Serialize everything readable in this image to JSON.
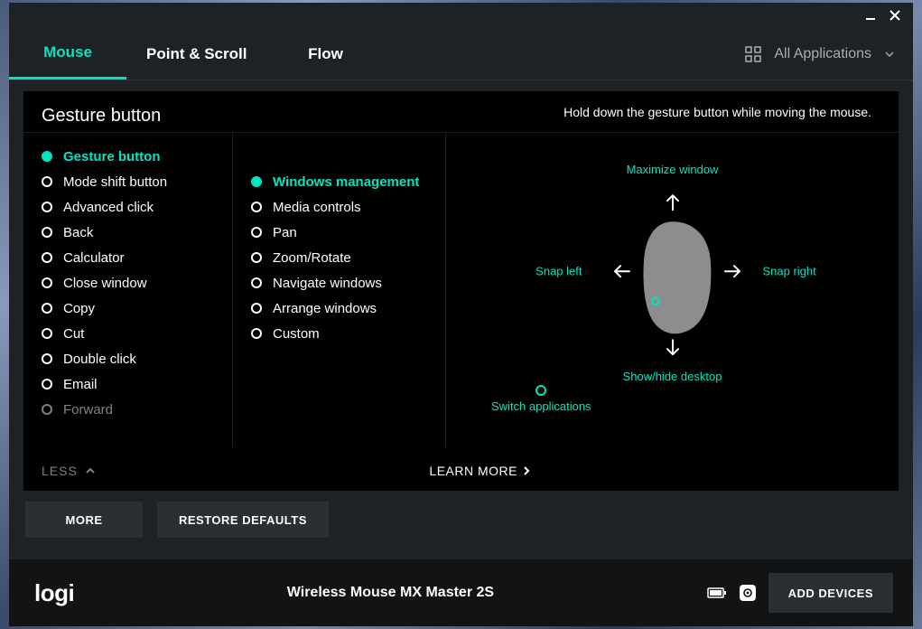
{
  "titlebar": {},
  "tabs": [
    {
      "label": "Mouse",
      "active": true
    },
    {
      "label": "Point & Scroll",
      "active": false
    },
    {
      "label": "Flow",
      "active": false
    }
  ],
  "apps_selector": {
    "label": "All Applications"
  },
  "panel": {
    "title": "Gesture button",
    "subtitle": "Hold down the gesture button while moving the mouse."
  },
  "col1": [
    "Gesture button",
    "Mode shift button",
    "Advanced click",
    "Back",
    "Calculator",
    "Close window",
    "Copy",
    "Cut",
    "Double click",
    "Email",
    "Forward"
  ],
  "col1_selected_index": 0,
  "col2": [
    "Windows management",
    "Media controls",
    "Pan",
    "Zoom/Rotate",
    "Navigate windows",
    "Arrange windows",
    "Custom"
  ],
  "col2_selected_index": 0,
  "gestures": {
    "up": "Maximize window",
    "down": "Show/hide desktop",
    "left": "Snap left",
    "right": "Snap right",
    "center": "Switch applications"
  },
  "less_label": "LESS",
  "learn_more_label": "LEARN MORE",
  "more_button": "MORE",
  "restore_button": "RESTORE DEFAULTS",
  "footer": {
    "logo": "logi",
    "device": "Wireless Mouse MX Master 2S",
    "add_devices": "ADD DEVICES"
  }
}
